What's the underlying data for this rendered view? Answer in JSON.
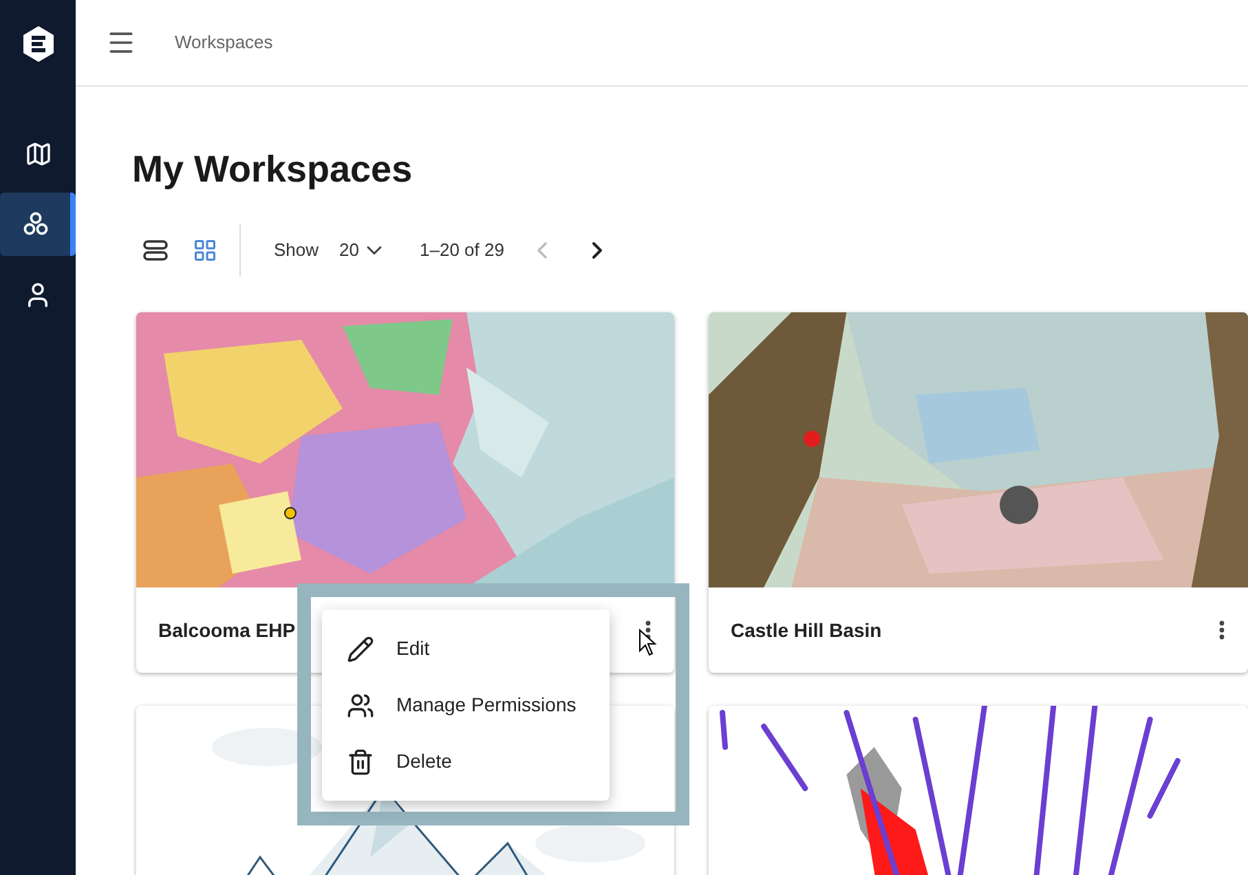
{
  "sidebar": {
    "items": [
      {
        "kind": "map",
        "selected": false
      },
      {
        "kind": "workspaces",
        "selected": true
      },
      {
        "kind": "user",
        "selected": false
      }
    ]
  },
  "header": {
    "breadcrumb": "Workspaces"
  },
  "page_title": "My Workspaces",
  "toolbar": {
    "views": [
      {
        "kind": "list",
        "selected": false
      },
      {
        "kind": "grid",
        "selected": true
      }
    ],
    "show_label": "Show",
    "page_size": "20",
    "range": "1–20 of 29",
    "prev_disabled": true,
    "next_disabled": false
  },
  "cards": [
    {
      "kind": "map",
      "title": "Balcooma EHP"
    },
    {
      "kind": "geology",
      "title": "Castle Hill Basin"
    },
    {
      "kind": "mountains"
    },
    {
      "kind": "drillholes"
    }
  ],
  "context_menu": {
    "items": [
      {
        "kind": "edit",
        "label": "Edit"
      },
      {
        "kind": "permissions",
        "label": "Manage Permissions"
      },
      {
        "kind": "delete",
        "label": "Delete"
      }
    ]
  }
}
